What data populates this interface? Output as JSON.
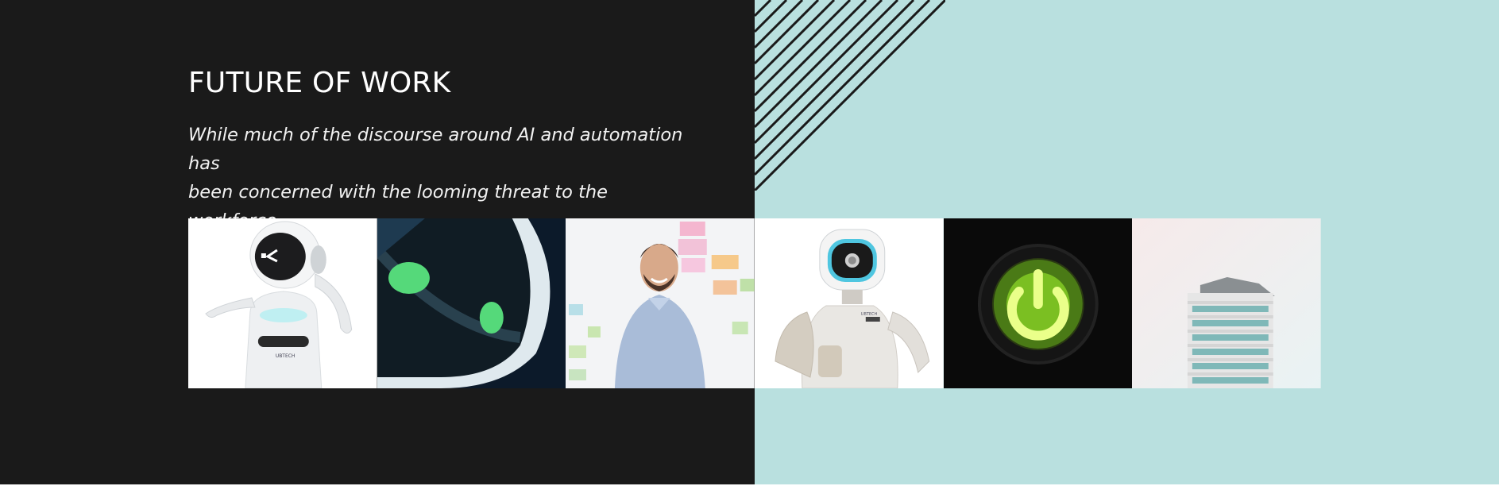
{
  "hero": {
    "title": "FUTURE OF WORK",
    "description_line1": "While much of the discourse around AI and automation has",
    "description_line2": "been concerned with the looming threat to the workforce..."
  },
  "colors": {
    "dark_panel": "#1a1a1a",
    "teal_panel": "#b9e0df",
    "power_glow": "#a8ff3e"
  },
  "gallery": {
    "items": [
      {
        "name": "robot-white-winking",
        "label": "UBTECH"
      },
      {
        "name": "robot-closeup-green-eyes"
      },
      {
        "name": "smiling-man-sticky-notes"
      },
      {
        "name": "humanoid-robot-silver",
        "label": "UBTECH"
      },
      {
        "name": "green-power-button"
      },
      {
        "name": "office-building-pink-sky"
      }
    ]
  }
}
